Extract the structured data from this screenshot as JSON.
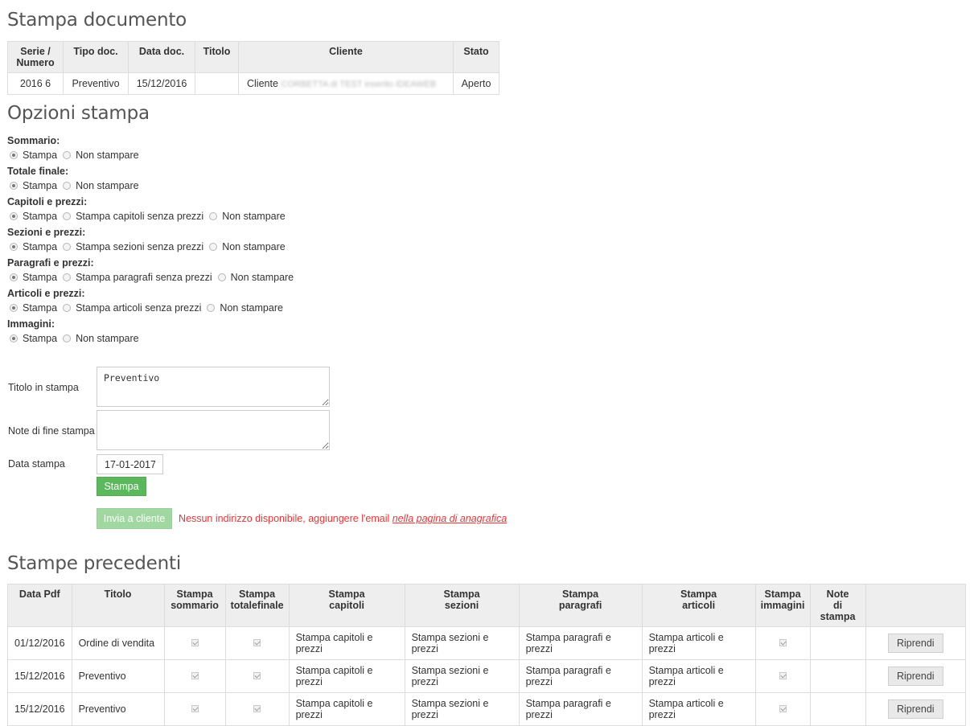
{
  "doc": {
    "title": "Stampa documento",
    "headers": [
      "Serie / Numero",
      "Tipo doc.",
      "Data doc.",
      "Titolo",
      "Cliente",
      "Stato"
    ],
    "row": {
      "serie": "2016 6",
      "tipo": "Preventivo",
      "data": "15/12/2016",
      "titolo": "",
      "cliente_prefix": "Cliente",
      "cliente_name": "CORBETTA di TEST inserito IDEAWEB",
      "stato": "Aperto"
    }
  },
  "options": {
    "title": "Opzioni stampa",
    "groups": [
      {
        "label": "Sommario:",
        "choices": [
          "Stampa",
          "Non stampare"
        ],
        "selected": 0
      },
      {
        "label": "Totale finale:",
        "choices": [
          "Stampa",
          "Non stampare"
        ],
        "selected": 0
      },
      {
        "label": "Capitoli e prezzi:",
        "choices": [
          "Stampa",
          "Stampa capitoli senza prezzi",
          "Non stampare"
        ],
        "selected": 0
      },
      {
        "label": "Sezioni e prezzi:",
        "choices": [
          "Stampa",
          "Stampa sezioni senza prezzi",
          "Non stampare"
        ],
        "selected": 0
      },
      {
        "label": "Paragrafi e prezzi:",
        "choices": [
          "Stampa",
          "Stampa paragrafi senza prezzi",
          "Non stampare"
        ],
        "selected": 0
      },
      {
        "label": "Articoli e prezzi:",
        "choices": [
          "Stampa",
          "Stampa articoli senza prezzi",
          "Non stampare"
        ],
        "selected": 0
      },
      {
        "label": "Immagini:",
        "choices": [
          "Stampa",
          "Non stampare"
        ],
        "selected": 0
      }
    ]
  },
  "form": {
    "titolo_label": "Titolo in stampa",
    "titolo_value": "Preventivo",
    "note_label": "Note di fine stampa",
    "note_value": "",
    "data_label": "Data stampa",
    "data_value": "17-01-2017",
    "stampa_button": "Stampa",
    "invia_button": "Invia a cliente",
    "warning_text": "Nessun indirizzo disponibile, aggiungere l'email ",
    "warning_link": "nella pagina di anagrafica"
  },
  "previous": {
    "title": "Stampe precedenti",
    "headers": [
      [
        "Data Pdf"
      ],
      [
        "Titolo"
      ],
      [
        "Stampa",
        "sommario"
      ],
      [
        "Stampa",
        "totalefinale"
      ],
      [
        "Stampa",
        "capitoli"
      ],
      [
        "Stampa",
        "sezioni"
      ],
      [
        "Stampa",
        "paragrafi"
      ],
      [
        "Stampa",
        "articoli"
      ],
      [
        "Stampa",
        "immagini"
      ],
      [
        "Note",
        "di stampa"
      ],
      [
        ""
      ]
    ],
    "rows": [
      {
        "data": "01/12/2016",
        "titolo": "Ordine di vendita",
        "sommario": true,
        "totale": true,
        "capitoli": "Stampa capitoli e prezzi",
        "sezioni": "Stampa sezioni e prezzi",
        "paragrafi": "Stampa paragrafi e prezzi",
        "articoli": "Stampa articoli e prezzi",
        "immagini": true,
        "note": "",
        "action": "Riprendi"
      },
      {
        "data": "15/12/2016",
        "titolo": "Preventivo",
        "sommario": true,
        "totale": true,
        "capitoli": "Stampa capitoli e prezzi",
        "sezioni": "Stampa sezioni e prezzi",
        "paragrafi": "Stampa paragrafi e prezzi",
        "articoli": "Stampa articoli e prezzi",
        "immagini": true,
        "note": "",
        "action": "Riprendi"
      },
      {
        "data": "15/12/2016",
        "titolo": "Preventivo",
        "sommario": true,
        "totale": true,
        "capitoli": "Stampa capitoli e prezzi",
        "sezioni": "Stampa sezioni e prezzi",
        "paragrafi": "Stampa paragrafi e prezzi",
        "articoli": "Stampa articoli e prezzi",
        "immagini": true,
        "note": "",
        "action": "Riprendi"
      }
    ]
  }
}
